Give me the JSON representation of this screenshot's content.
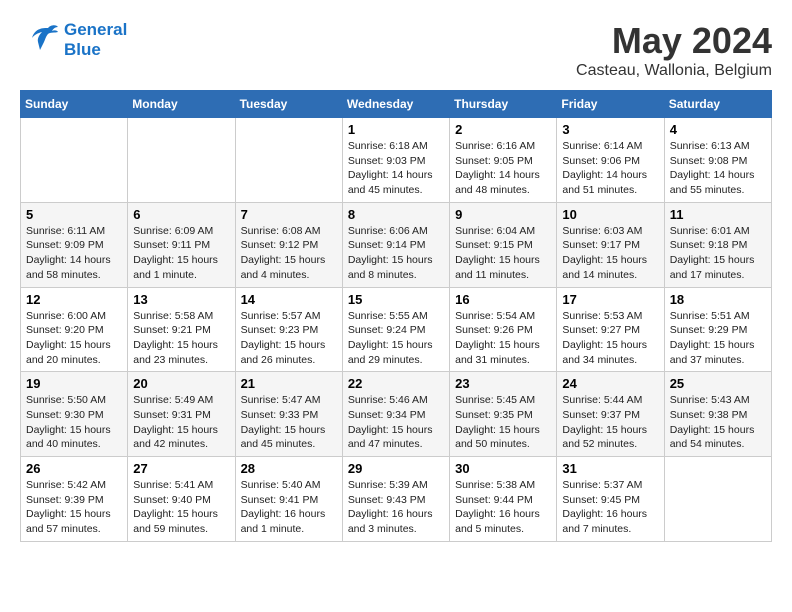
{
  "header": {
    "logo_line1": "General",
    "logo_line2": "Blue",
    "title": "May 2024",
    "subtitle": "Casteau, Wallonia, Belgium"
  },
  "days_of_week": [
    "Sunday",
    "Monday",
    "Tuesday",
    "Wednesday",
    "Thursday",
    "Friday",
    "Saturday"
  ],
  "weeks": [
    [
      {
        "day": "",
        "info": ""
      },
      {
        "day": "",
        "info": ""
      },
      {
        "day": "",
        "info": ""
      },
      {
        "day": "1",
        "info": "Sunrise: 6:18 AM\nSunset: 9:03 PM\nDaylight: 14 hours\nand 45 minutes."
      },
      {
        "day": "2",
        "info": "Sunrise: 6:16 AM\nSunset: 9:05 PM\nDaylight: 14 hours\nand 48 minutes."
      },
      {
        "day": "3",
        "info": "Sunrise: 6:14 AM\nSunset: 9:06 PM\nDaylight: 14 hours\nand 51 minutes."
      },
      {
        "day": "4",
        "info": "Sunrise: 6:13 AM\nSunset: 9:08 PM\nDaylight: 14 hours\nand 55 minutes."
      }
    ],
    [
      {
        "day": "5",
        "info": "Sunrise: 6:11 AM\nSunset: 9:09 PM\nDaylight: 14 hours\nand 58 minutes."
      },
      {
        "day": "6",
        "info": "Sunrise: 6:09 AM\nSunset: 9:11 PM\nDaylight: 15 hours\nand 1 minute."
      },
      {
        "day": "7",
        "info": "Sunrise: 6:08 AM\nSunset: 9:12 PM\nDaylight: 15 hours\nand 4 minutes."
      },
      {
        "day": "8",
        "info": "Sunrise: 6:06 AM\nSunset: 9:14 PM\nDaylight: 15 hours\nand 8 minutes."
      },
      {
        "day": "9",
        "info": "Sunrise: 6:04 AM\nSunset: 9:15 PM\nDaylight: 15 hours\nand 11 minutes."
      },
      {
        "day": "10",
        "info": "Sunrise: 6:03 AM\nSunset: 9:17 PM\nDaylight: 15 hours\nand 14 minutes."
      },
      {
        "day": "11",
        "info": "Sunrise: 6:01 AM\nSunset: 9:18 PM\nDaylight: 15 hours\nand 17 minutes."
      }
    ],
    [
      {
        "day": "12",
        "info": "Sunrise: 6:00 AM\nSunset: 9:20 PM\nDaylight: 15 hours\nand 20 minutes."
      },
      {
        "day": "13",
        "info": "Sunrise: 5:58 AM\nSunset: 9:21 PM\nDaylight: 15 hours\nand 23 minutes."
      },
      {
        "day": "14",
        "info": "Sunrise: 5:57 AM\nSunset: 9:23 PM\nDaylight: 15 hours\nand 26 minutes."
      },
      {
        "day": "15",
        "info": "Sunrise: 5:55 AM\nSunset: 9:24 PM\nDaylight: 15 hours\nand 29 minutes."
      },
      {
        "day": "16",
        "info": "Sunrise: 5:54 AM\nSunset: 9:26 PM\nDaylight: 15 hours\nand 31 minutes."
      },
      {
        "day": "17",
        "info": "Sunrise: 5:53 AM\nSunset: 9:27 PM\nDaylight: 15 hours\nand 34 minutes."
      },
      {
        "day": "18",
        "info": "Sunrise: 5:51 AM\nSunset: 9:29 PM\nDaylight: 15 hours\nand 37 minutes."
      }
    ],
    [
      {
        "day": "19",
        "info": "Sunrise: 5:50 AM\nSunset: 9:30 PM\nDaylight: 15 hours\nand 40 minutes."
      },
      {
        "day": "20",
        "info": "Sunrise: 5:49 AM\nSunset: 9:31 PM\nDaylight: 15 hours\nand 42 minutes."
      },
      {
        "day": "21",
        "info": "Sunrise: 5:47 AM\nSunset: 9:33 PM\nDaylight: 15 hours\nand 45 minutes."
      },
      {
        "day": "22",
        "info": "Sunrise: 5:46 AM\nSunset: 9:34 PM\nDaylight: 15 hours\nand 47 minutes."
      },
      {
        "day": "23",
        "info": "Sunrise: 5:45 AM\nSunset: 9:35 PM\nDaylight: 15 hours\nand 50 minutes."
      },
      {
        "day": "24",
        "info": "Sunrise: 5:44 AM\nSunset: 9:37 PM\nDaylight: 15 hours\nand 52 minutes."
      },
      {
        "day": "25",
        "info": "Sunrise: 5:43 AM\nSunset: 9:38 PM\nDaylight: 15 hours\nand 54 minutes."
      }
    ],
    [
      {
        "day": "26",
        "info": "Sunrise: 5:42 AM\nSunset: 9:39 PM\nDaylight: 15 hours\nand 57 minutes."
      },
      {
        "day": "27",
        "info": "Sunrise: 5:41 AM\nSunset: 9:40 PM\nDaylight: 15 hours\nand 59 minutes."
      },
      {
        "day": "28",
        "info": "Sunrise: 5:40 AM\nSunset: 9:41 PM\nDaylight: 16 hours\nand 1 minute."
      },
      {
        "day": "29",
        "info": "Sunrise: 5:39 AM\nSunset: 9:43 PM\nDaylight: 16 hours\nand 3 minutes."
      },
      {
        "day": "30",
        "info": "Sunrise: 5:38 AM\nSunset: 9:44 PM\nDaylight: 16 hours\nand 5 minutes."
      },
      {
        "day": "31",
        "info": "Sunrise: 5:37 AM\nSunset: 9:45 PM\nDaylight: 16 hours\nand 7 minutes."
      },
      {
        "day": "",
        "info": ""
      }
    ]
  ]
}
